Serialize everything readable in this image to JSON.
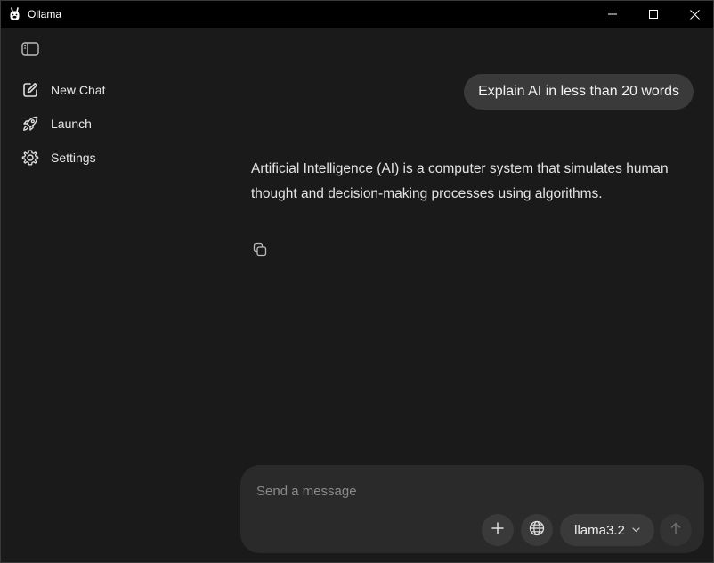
{
  "window": {
    "title": "Ollama",
    "icons": {
      "app": "ollama-llama-icon",
      "minimize": "minimize-icon",
      "maximize": "maximize-icon",
      "close": "close-icon"
    }
  },
  "sidebar": {
    "toggle_icon": "sidebar-toggle-icon",
    "items": [
      {
        "label": "New Chat",
        "icon": "compose-icon"
      },
      {
        "label": "Launch",
        "icon": "rocket-icon"
      },
      {
        "label": "Settings",
        "icon": "gear-icon"
      }
    ]
  },
  "chat": {
    "user_message": "Explain AI in less than 20 words",
    "assistant_message": "Artificial Intelligence (AI) is a computer system that simulates human thought and decision-making processes using algorithms.",
    "copy_icon": "copy-icon"
  },
  "composer": {
    "placeholder": "Send a message",
    "value": "",
    "model": "llama3.2",
    "icons": {
      "add": "plus-icon",
      "web": "globe-icon",
      "model_dropdown": "chevron-down-icon",
      "send": "arrow-up-icon"
    }
  },
  "colors": {
    "background": "#1a1a1a",
    "titlebar": "#000000",
    "bubble": "#3a3a3a",
    "composer": "#2a2a2a",
    "text": "#e8e8e8",
    "placeholder": "#8a8a8a"
  }
}
